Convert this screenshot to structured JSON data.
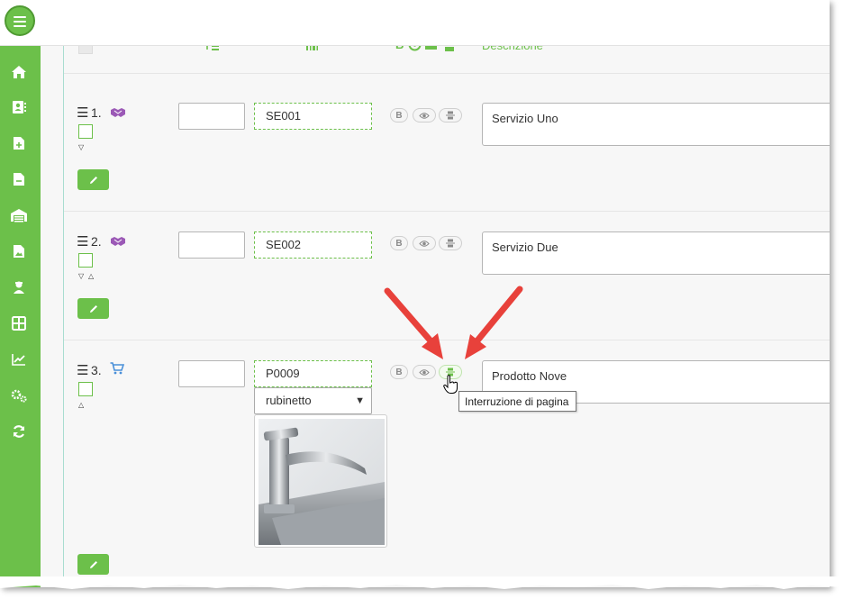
{
  "header": {
    "columns": {
      "descrizione": "Descrizione",
      "bold_marker": "B"
    }
  },
  "colors": {
    "accent": "#6cc04a",
    "annotation_arrow": "#e8413b",
    "service_icon": "#9b59b6",
    "cart_icon": "#4a90d9"
  },
  "rows": [
    {
      "number": "1.",
      "type_icon": "handshake-icon",
      "code": "SE001",
      "description": "Servizio Uno",
      "bold_label": "B"
    },
    {
      "number": "2.",
      "type_icon": "handshake-icon",
      "code": "SE002",
      "description": "Servizio Due",
      "bold_label": "B"
    },
    {
      "number": "3.",
      "type_icon": "cart-icon",
      "code": "P0009",
      "description": "Prodotto Nove",
      "bold_label": "B",
      "variant_selected": "rubinetto"
    }
  ],
  "tooltip": {
    "text": "Interruzione di pagina"
  },
  "sidebar": {
    "items": [
      "home-icon",
      "contacts-icon",
      "document-add-icon",
      "document-remove-icon",
      "warehouse-icon",
      "image-file-icon",
      "user-icon",
      "grid-icon",
      "chart-icon",
      "settings-icon",
      "refresh-icon"
    ]
  }
}
